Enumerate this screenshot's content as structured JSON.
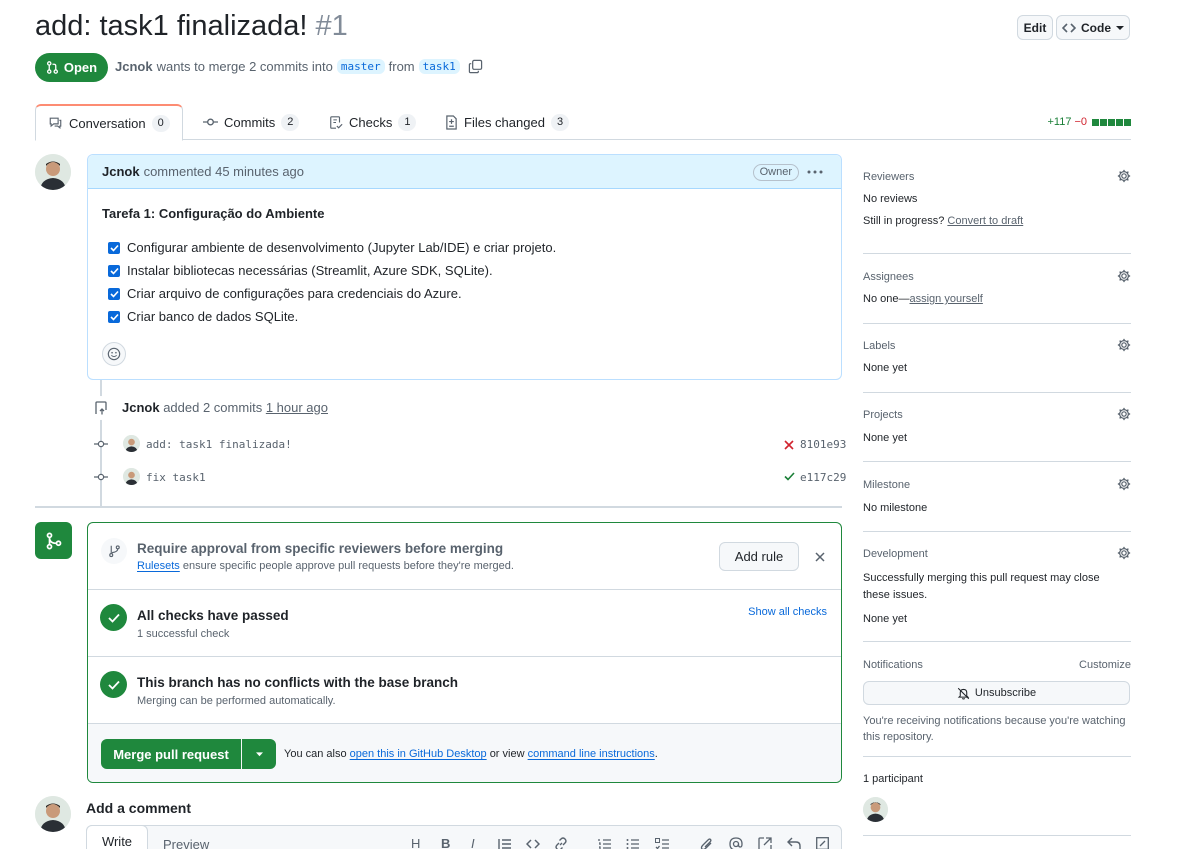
{
  "pr": {
    "title": "add: task1 finalizada!",
    "number": "#1",
    "state": "Open",
    "author": "Jcnok",
    "merge_text": "wants to merge 2 commits into",
    "base_branch": "master",
    "from_text": "from",
    "head_branch": "task1"
  },
  "header_buttons": {
    "edit": "Edit",
    "code": "Code"
  },
  "tabs": [
    {
      "label": "Conversation",
      "count": "0"
    },
    {
      "label": "Commits",
      "count": "2"
    },
    {
      "label": "Checks",
      "count": "1"
    },
    {
      "label": "Files changed",
      "count": "3"
    }
  ],
  "diffstat": {
    "additions": "+117",
    "deletions": "−0"
  },
  "comment": {
    "author": "Jcnok",
    "meta": "commented 45 minutes ago",
    "badge": "Owner",
    "heading": "Tarefa 1: Configuração do Ambiente",
    "tasks": [
      "Configurar ambiente de desenvolvimento (Jupyter Lab/IDE) e criar projeto.",
      "Instalar bibliotecas necessárias (Streamlit, Azure SDK, SQLite).",
      "Criar arquivo de configurações para credenciais do Azure.",
      "Criar banco de dados SQLite."
    ]
  },
  "commits_event": {
    "author": "Jcnok",
    "text": "added 2 commits",
    "time": "1 hour ago",
    "commits": [
      {
        "message": "add: task1 finalizada!",
        "sha": "8101e93",
        "status": "failed"
      },
      {
        "message": "fix task1",
        "sha": "e117c29",
        "status": "passed"
      }
    ]
  },
  "merge": {
    "rules_title": "Require approval from specific reviewers before merging",
    "rules_link": "Rulesets",
    "rules_desc": "ensure specific people approve pull requests before they're merged.",
    "add_rule": "Add rule",
    "checks_title": "All checks have passed",
    "checks_sub": "1 successful check",
    "show_checks": "Show all checks",
    "conflicts_title": "This branch has no conflicts with the base branch",
    "conflicts_sub": "Merging can be performed automatically.",
    "merge_button": "Merge pull request",
    "also_text": "You can also",
    "desktop_link": "open this in GitHub Desktop",
    "or_view": "or view",
    "cli_link": "command line instructions",
    "period": "."
  },
  "add_comment": {
    "title": "Add a comment",
    "write_tab": "Write",
    "preview_tab": "Preview"
  },
  "sidebar": {
    "reviewers": {
      "title": "Reviewers",
      "value": "No reviews",
      "progress": "Still in progress?",
      "draft_link": "Convert to draft"
    },
    "assignees": {
      "title": "Assignees",
      "value": "No one—",
      "assign_link": "assign yourself"
    },
    "labels": {
      "title": "Labels",
      "value": "None yet"
    },
    "projects": {
      "title": "Projects",
      "value": "None yet"
    },
    "milestone": {
      "title": "Milestone",
      "value": "No milestone"
    },
    "development": {
      "title": "Development",
      "desc": "Successfully merging this pull request may close these issues.",
      "value": "None yet"
    },
    "notifications": {
      "title": "Notifications",
      "customize": "Customize",
      "unsubscribe": "Unsubscribe",
      "desc": "You're receiving notifications because you're watching this repository."
    },
    "participants": {
      "title": "1 participant"
    }
  },
  "colors": {
    "accent": "#0969da",
    "success": "#1f883d",
    "danger": "#d1242f",
    "tab_indicator": "#fd8c73"
  }
}
